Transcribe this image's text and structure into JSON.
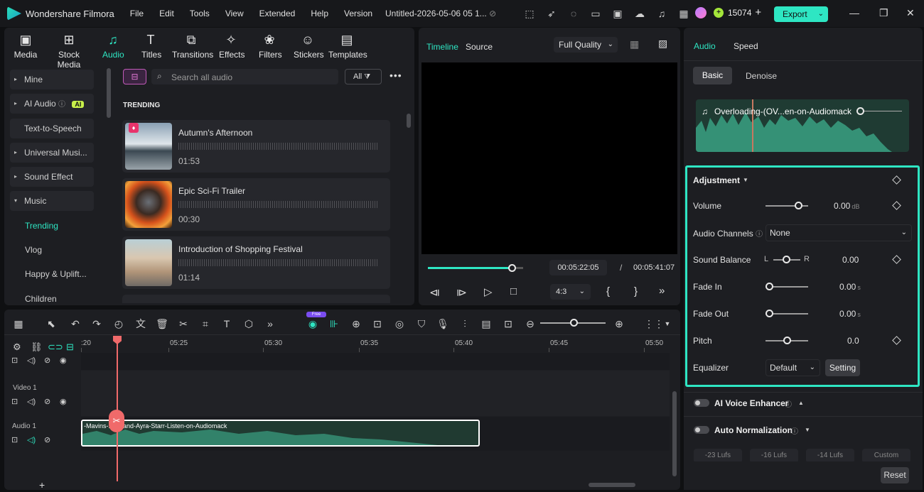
{
  "app": {
    "name": "Wondershare Filmora",
    "project_title": "Untitled-2026-05-06 05 1...",
    "credits": "15074",
    "export_label": "Export"
  },
  "menu": [
    "File",
    "Edit",
    "Tools",
    "View",
    "Extended",
    "Help",
    "Version"
  ],
  "toolbar": [
    {
      "label": "Media",
      "icon": "media-icon"
    },
    {
      "label": "Stock Media",
      "icon": "stock-media-icon"
    },
    {
      "label": "Audio",
      "icon": "audio-icon",
      "active": true
    },
    {
      "label": "Titles",
      "icon": "titles-icon"
    },
    {
      "label": "Transitions",
      "icon": "transitions-icon"
    },
    {
      "label": "Effects",
      "icon": "effects-icon"
    },
    {
      "label": "Filters",
      "icon": "filters-icon"
    },
    {
      "label": "Stickers",
      "icon": "stickers-icon"
    },
    {
      "label": "Templates",
      "icon": "templates-icon"
    }
  ],
  "sidebar": {
    "mine": "Mine",
    "ai_audio": "AI Audio",
    "ai_badge": "AI",
    "tts": "Text-to-Speech",
    "universal": "Universal Musi...",
    "sound_effect": "Sound Effect",
    "music": "Music",
    "trending": "Trending",
    "vlog": "Vlog",
    "happy": "Happy & Uplift...",
    "children": "Children"
  },
  "library": {
    "search_placeholder": "Search all audio",
    "filter_label": "All",
    "section": "TRENDING",
    "items": [
      {
        "name": "Autumn's Afternoon",
        "duration": "01:53"
      },
      {
        "name": "Epic Sci-Fi Trailer",
        "duration": "00:30"
      },
      {
        "name": "Introduction of Shopping Festival",
        "duration": "01:14"
      }
    ]
  },
  "player": {
    "tab_timeline": "Timeline",
    "tab_source": "Source",
    "quality": "Full Quality",
    "current_time": "00:05:22:05",
    "separator": "/",
    "total_time": "00:05:41:07",
    "aspect": "4:3",
    "progress": 0.89
  },
  "inspector": {
    "tab_audio": "Audio",
    "tab_speed": "Speed",
    "sub_basic": "Basic",
    "sub_denoise": "Denoise",
    "clip_name": "Overloading-(OV...en-on-Audiomack",
    "adjustment": "Adjustment",
    "volume_label": "Volume",
    "volume_value": "0.00",
    "volume_unit": "dB",
    "channels_label": "Audio Channels",
    "channels_value": "None",
    "balance_label": "Sound Balance",
    "balance_l": "L",
    "balance_r": "R",
    "balance_value": "0.00",
    "fadein_label": "Fade In",
    "fadein_value": "0.00",
    "fadeout_label": "Fade Out",
    "fadeout_value": "0.00",
    "sec_unit": "s",
    "pitch_label": "Pitch",
    "pitch_value": "0.0",
    "eq_label": "Equalizer",
    "eq_value": "Default",
    "eq_setting": "Setting",
    "ai_voice": "AI Voice Enhancer",
    "auto_norm": "Auto Normalization",
    "presets": [
      "-23 Lufs",
      "-16 Lufs",
      "-14 Lufs",
      "Custom"
    ],
    "reset": "Reset"
  },
  "timeline": {
    "free_badge": "Free",
    "ruler": [
      ":20",
      "05:25",
      "05:30",
      "05:35",
      "05:40",
      "05:45",
      "05:50"
    ],
    "video_track": "Video 1",
    "audio_track": "Audio 1",
    "audio_clip": "-Mavins-...on-and-Ayra-Starr-Listen-on-Audiomack"
  },
  "colors": {
    "accent": "#2ee6c3",
    "bg": "#0f1012",
    "panel": "#1d1e22"
  }
}
